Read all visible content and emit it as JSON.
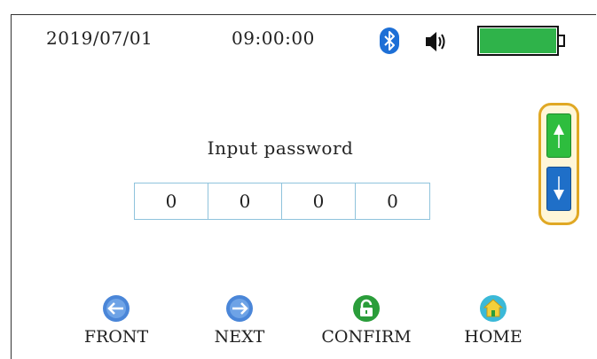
{
  "status_bar": {
    "date": "2019/07/01",
    "time": "09:00:00",
    "bluetooth_icon": "bluetooth-icon",
    "volume_icon": "speaker-icon",
    "battery_level_percent": 100,
    "battery_color": "#2fb34a"
  },
  "main": {
    "prompt": "Input password",
    "digits": [
      "0",
      "0",
      "0",
      "0"
    ]
  },
  "scroll": {
    "up_icon": "arrow-up-icon",
    "down_icon": "arrow-down-icon",
    "up_color": "#2ebd3e",
    "down_color": "#1f6fc8"
  },
  "nav": [
    {
      "label": "FRONT",
      "icon": "arrow-left-icon",
      "color": "#4a86d8"
    },
    {
      "label": "NEXT",
      "icon": "arrow-right-icon",
      "color": "#4a86d8"
    },
    {
      "label": "CONFIRM",
      "icon": "lock-icon",
      "color": "#2a9d3a"
    },
    {
      "label": "HOME",
      "icon": "home-icon",
      "color": "#3bb9d8"
    }
  ]
}
